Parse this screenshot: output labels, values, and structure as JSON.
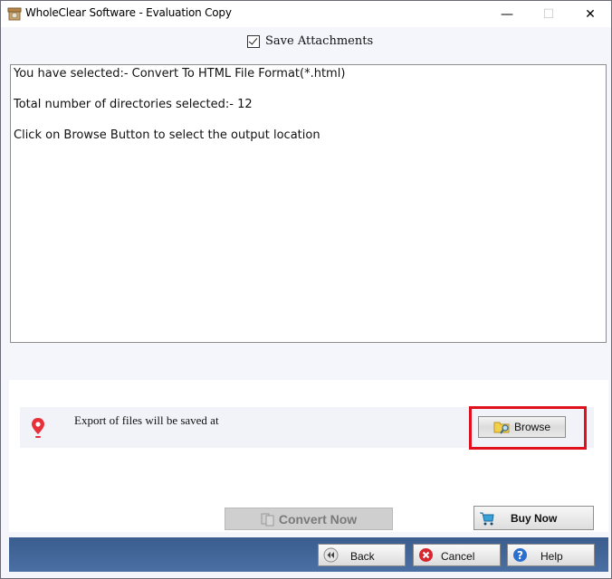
{
  "window": {
    "title": "WholeClear Software - Evaluation Copy",
    "controls": {
      "minimize": "—",
      "maximize": "☐",
      "close": "✕"
    }
  },
  "options": {
    "save_attachments_label": "Save Attachments",
    "save_attachments_checked": true
  },
  "log": {
    "lines": [
      "You have selected:- Convert To HTML File Format(*.html)",
      "Total number of directories selected:- 12",
      "Click on Browse Button to select the output location"
    ]
  },
  "export": {
    "label": "Export of files will be saved at",
    "icon": "location-pin-icon",
    "browse_label": "Browse",
    "highlight_color": "#e0101c"
  },
  "actions": {
    "convert_label": "Convert Now",
    "convert_enabled": false,
    "buy_label": "Buy Now"
  },
  "footer": {
    "back_label": "Back",
    "cancel_label": "Cancel",
    "help_label": "Help",
    "bar_color": "#44679b"
  }
}
